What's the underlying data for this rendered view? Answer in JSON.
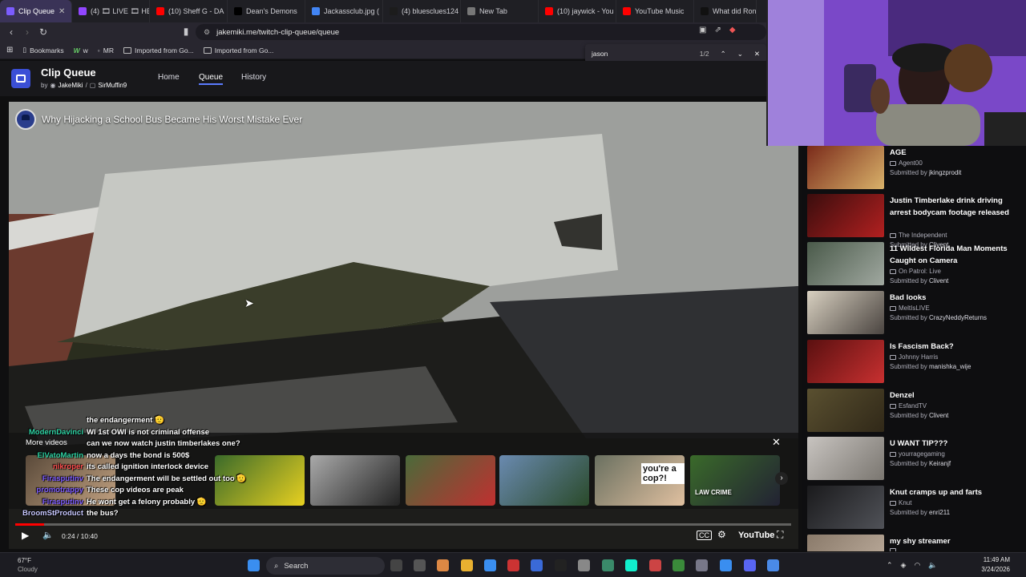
{
  "browser": {
    "tabs": [
      {
        "label": "Clip Queue",
        "color": "#7b5cff",
        "active": true
      },
      {
        "label": "(4) 🎞 LIVE 🎞 HE",
        "color": "#9146ff"
      },
      {
        "label": "(10) Sheff G - DA",
        "color": "#ff0000"
      },
      {
        "label": "Dean's Demons",
        "color": "#000000"
      },
      {
        "label": "Jackassclub.jpg (",
        "color": "#4285f4"
      },
      {
        "label": "(4) bluesclues124",
        "color": "#1c1c1c"
      },
      {
        "label": "New Tab",
        "color": "#777777"
      },
      {
        "label": "(10) jaywick - You",
        "color": "#ff0000"
      },
      {
        "label": "YouTube Music",
        "color": "#ff0000"
      },
      {
        "label": "What did Ron do",
        "color": "#111111"
      }
    ],
    "url": "jakemiki.me/twitch-clip-queue/queue",
    "bookmarks": [
      {
        "label": "Bookmarks"
      },
      {
        "label": "w"
      },
      {
        "label": "MR"
      },
      {
        "label": "Imported from Go..."
      },
      {
        "label": "Imported from Go..."
      }
    ],
    "find": {
      "query": "jason",
      "count": "1/2"
    }
  },
  "app": {
    "title": "Clip Queue",
    "by": "by",
    "author1": "JakeMiki",
    "sep": "/",
    "author2": "SirMuffin9",
    "nav": [
      {
        "label": "Home"
      },
      {
        "label": "Queue",
        "active": true
      },
      {
        "label": "History"
      }
    ]
  },
  "player": {
    "video_title": "Why Hijacking a School Bus Became His Worst Mistake Ever",
    "more_videos_label": "More videos",
    "time": "0:24 / 10:40",
    "progress": 0.0375,
    "brand": "YouTube",
    "thumb_texts": [
      "",
      "",
      "",
      "",
      "",
      "you're a cop?!",
      "LAW CRIME"
    ]
  },
  "chat": [
    {
      "name": "",
      "color": "#9bd16a",
      "msg": "the endangerment 🫡"
    },
    {
      "name": "ModernDavinci",
      "color": "#2ed3a4",
      "msg": "WI 1st OWI is not criminal offense"
    },
    {
      "name": "",
      "color": "#2ed3a4",
      "msg": ""
    },
    {
      "name": "",
      "color": "#2ed3a4",
      "msg": "can we now watch justin timberlakes one?"
    },
    {
      "name": "ElVatoMartin",
      "color": "#2ed3a4",
      "msg": "now a days the bond is 500$"
    },
    {
      "name": "nikroper",
      "color": "#ff4f4f",
      "msg": "its called ignition interlock device"
    },
    {
      "name": "Firasputinv",
      "color": "#7d5cff",
      "msg": "The endangerment will be settled out too 🫡"
    },
    {
      "name": "promotrappy",
      "color": "#7d5cff",
      "msg": "These cop videos are peak"
    },
    {
      "name": "Firasputinv",
      "color": "#7d5cff",
      "msg": "He wont get a felony probably 🫡"
    },
    {
      "name": "BroomStProduct",
      "color": "#c8c8ff",
      "msg": "the bus?"
    }
  ],
  "queue": [
    {
      "title": "AGE",
      "channel": "Agent00",
      "submitter": "jkingzprodit",
      "colors": [
        "#7a2a1a",
        "#d9b26a"
      ]
    },
    {
      "title": "Justin Timberlake drink driving arrest bodycam footage released",
      "channel": "The Independent",
      "submitter": "Clivent",
      "colors": [
        "#3a0d0d",
        "#b22020"
      ]
    },
    {
      "title": "11 Wildest Florida Man Moments Caught on Camera",
      "channel": "On Patrol: Live",
      "submitter": "Clivent",
      "colors": [
        "#4a5a4a",
        "#a0a8a0"
      ]
    },
    {
      "title": "Bad looks",
      "channel": "MeltIsLIVE",
      "submitter": "CrazyNeddyReturns",
      "colors": [
        "#d8d0c0",
        "#4a4440"
      ]
    },
    {
      "title": "Is Fascism Back?",
      "channel": "Johnny Harris",
      "submitter": "manishka_wije",
      "colors": [
        "#5a1010",
        "#c83030"
      ]
    },
    {
      "title": "Denzel",
      "channel": "EsfandTV",
      "submitter": "Clivent",
      "colors": [
        "#5a5030",
        "#302818"
      ]
    },
    {
      "title": "U WANT TIP???",
      "channel": "yourragegaming",
      "submitter": "Keiranjf",
      "colors": [
        "#c8c4c0",
        "#7a7670"
      ]
    },
    {
      "title": "Knut cramps up and farts",
      "channel": "Knut",
      "submitter": "enri211",
      "colors": [
        "#1a1a1c",
        "#505258"
      ]
    },
    {
      "title": "my shy streamer",
      "channel": "",
      "submitter": "",
      "colors": [
        "#8a7a6a",
        "#c0b0a0"
      ]
    }
  ],
  "labels": {
    "submitted_by": "Submitted by"
  },
  "taskbar": {
    "search": "Search",
    "weather_temp": "67°F",
    "weather_desc": "Cloudy",
    "time": "11:49 AM",
    "date": "3/24/2026"
  }
}
